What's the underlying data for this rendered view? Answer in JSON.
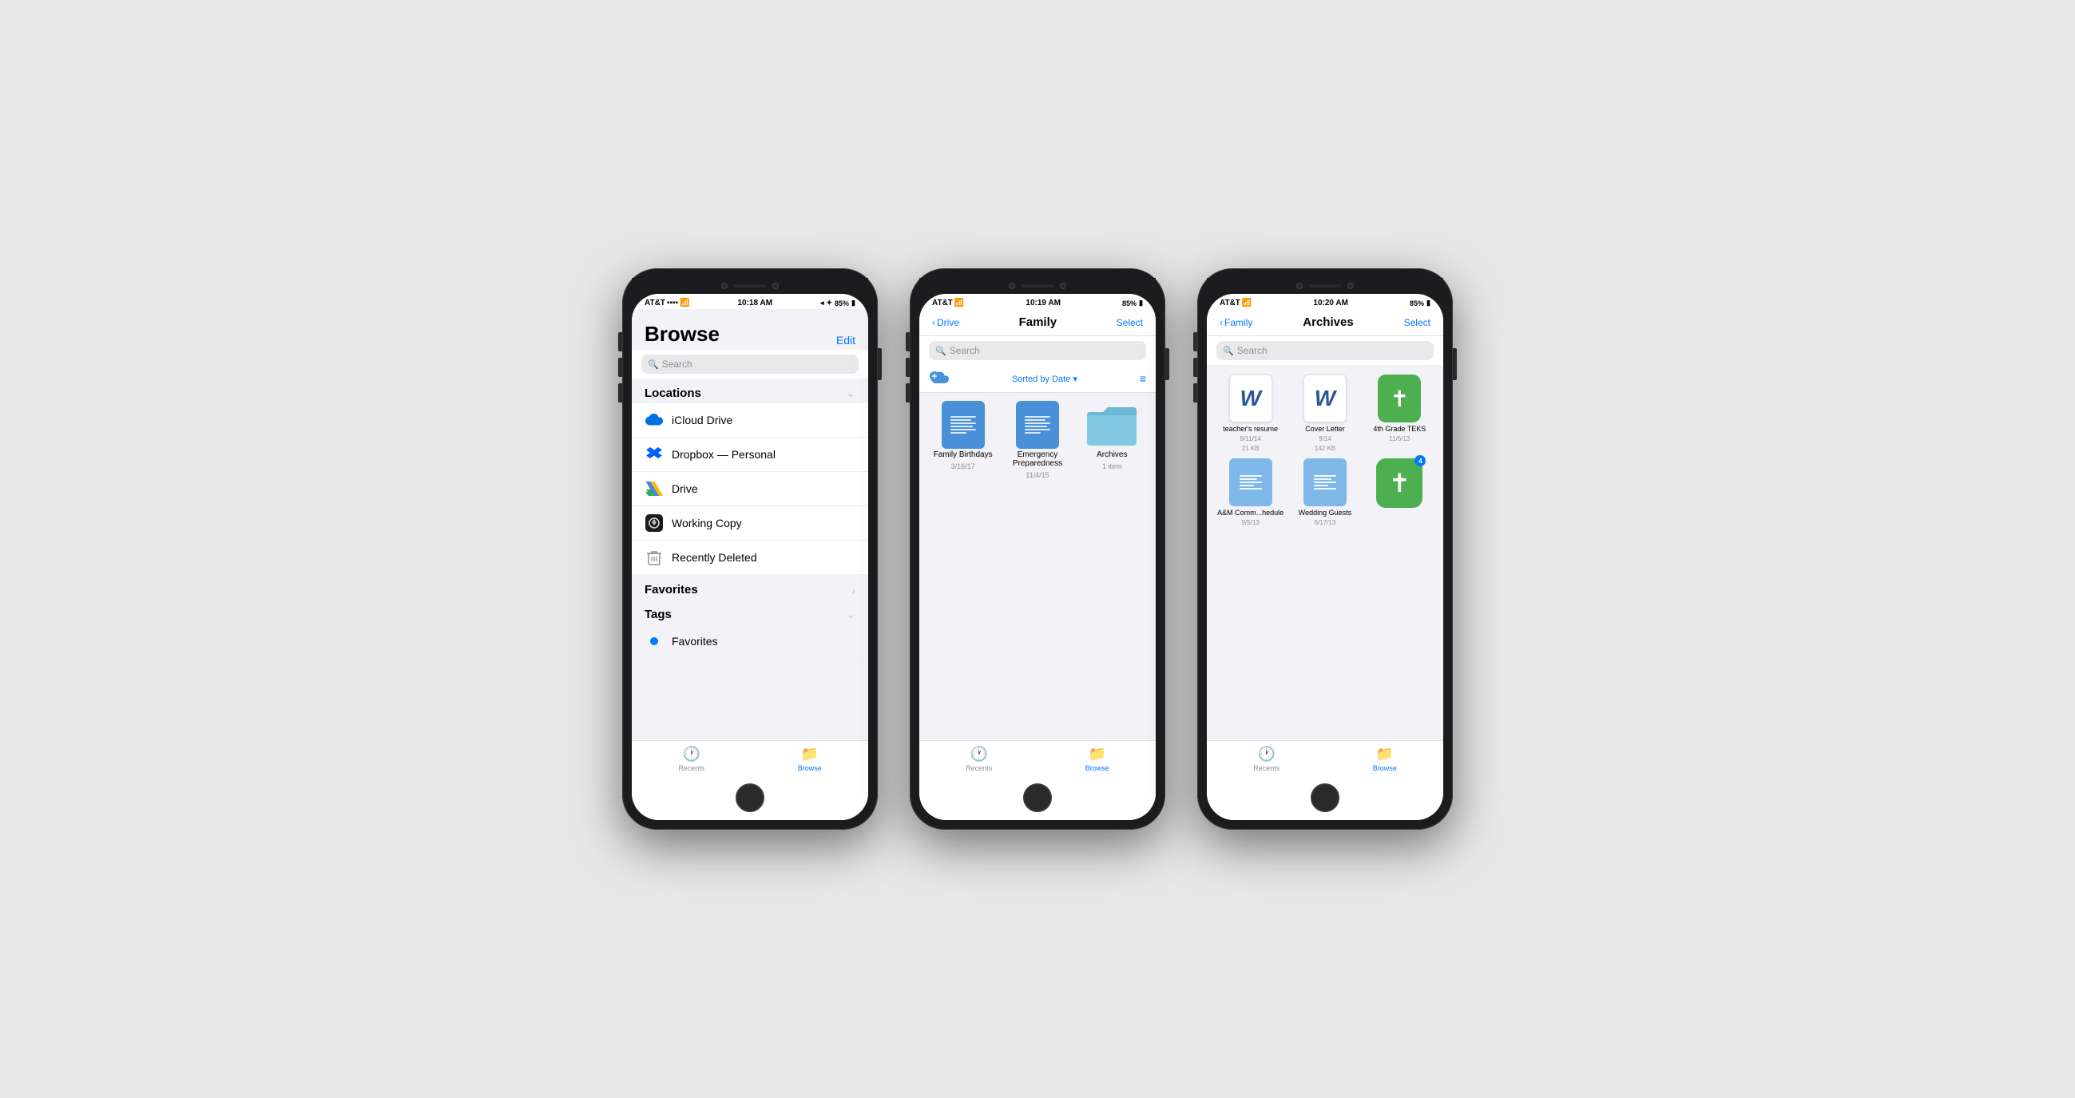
{
  "phone1": {
    "status": {
      "carrier": "AT&T",
      "time": "10:18 AM",
      "battery": "85%"
    },
    "nav": {
      "title": "Browse",
      "edit": "Edit"
    },
    "search": {
      "placeholder": "Search"
    },
    "locations": {
      "title": "Locations",
      "items": [
        {
          "id": "icloud",
          "label": "iCloud Drive"
        },
        {
          "id": "dropbox",
          "label": "Dropbox — Personal"
        },
        {
          "id": "gdrive",
          "label": "Drive"
        },
        {
          "id": "workcopy",
          "label": "Working Copy"
        },
        {
          "id": "trash",
          "label": "Recently Deleted"
        }
      ]
    },
    "favorites": {
      "title": "Favorites"
    },
    "tags": {
      "title": "Tags",
      "items": [
        {
          "label": "Favorites"
        }
      ]
    },
    "tabs": [
      {
        "id": "recents",
        "label": "Recents",
        "active": false
      },
      {
        "id": "browse",
        "label": "Browse",
        "active": true
      }
    ]
  },
  "phone2": {
    "status": {
      "carrier": "AT&T",
      "time": "10:19 AM",
      "battery": "85%"
    },
    "nav": {
      "back": "Drive",
      "title": "Family",
      "action": "Select"
    },
    "search": {
      "placeholder": "Search"
    },
    "toolbar": {
      "sort": "Sorted by Date ▾"
    },
    "folders": [
      {
        "id": "birthdays",
        "name": "Family Birthdays",
        "date": "3/16/17",
        "type": "doc"
      },
      {
        "id": "emergency",
        "name": "Emergency Preparedness",
        "date": "11/4/15",
        "type": "doc"
      },
      {
        "id": "archives",
        "name": "Archives",
        "count": "1 item",
        "type": "folder"
      }
    ],
    "tabs": [
      {
        "id": "recents",
        "label": "Recents",
        "active": false
      },
      {
        "id": "browse",
        "label": "Browse",
        "active": true
      }
    ]
  },
  "phone3": {
    "status": {
      "carrier": "AT&T",
      "time": "10:20 AM",
      "battery": "85%"
    },
    "nav": {
      "back": "Family",
      "title": "Archives",
      "action": "Select"
    },
    "search": {
      "placeholder": "Search"
    },
    "files": [
      {
        "id": "resume",
        "name": "teacher's resume",
        "date": "9/11/14",
        "size": "21 KB",
        "type": "word"
      },
      {
        "id": "cover",
        "name": "Cover Letter",
        "date": "9/14",
        "size": "142 KB",
        "type": "word"
      },
      {
        "id": "teks",
        "name": "4th Grade TEKS",
        "date": "11/6/13",
        "type": "cross"
      },
      {
        "id": "comm",
        "name": "A&M Comm...hedule",
        "date": "9/5/13",
        "type": "sheets"
      },
      {
        "id": "wedding",
        "name": "Wedding Guests",
        "date": "6/17/13",
        "type": "sheets"
      },
      {
        "id": "popup",
        "name": "",
        "badge": "4",
        "type": "popup"
      }
    ],
    "tabs": [
      {
        "id": "recents",
        "label": "Recents",
        "active": false
      },
      {
        "id": "browse",
        "label": "Browse",
        "active": true
      }
    ]
  }
}
